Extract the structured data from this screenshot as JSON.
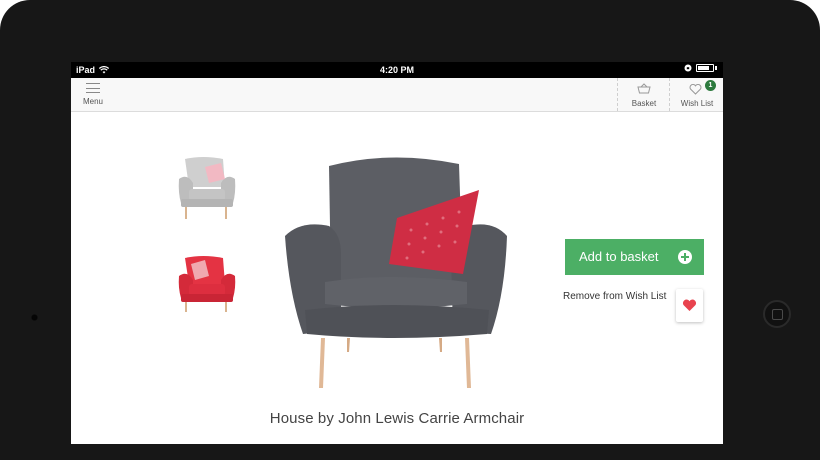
{
  "statusbar": {
    "device": "iPad",
    "time": "4:20 PM"
  },
  "navbar": {
    "menu_label": "Menu",
    "basket_label": "Basket",
    "wishlist_label": "Wish List",
    "wishlist_count": "1"
  },
  "product": {
    "title": "House by John Lewis Carrie Armchair",
    "thumbnails": [
      {
        "name": "grey-chair-thumbnail",
        "color": "#c8c8c8"
      },
      {
        "name": "red-chair-thumbnail",
        "color": "#e0283a"
      }
    ],
    "main_image": {
      "chair_color": "#5b5d63",
      "cushion_color": "#cf2d44"
    }
  },
  "actions": {
    "add_to_basket_label": "Add to basket",
    "remove_wishlist_label": "Remove from Wish List"
  },
  "colors": {
    "accent_green": "#4caf65",
    "badge_green": "#2d7a3e",
    "heart_red": "#e8434e"
  }
}
